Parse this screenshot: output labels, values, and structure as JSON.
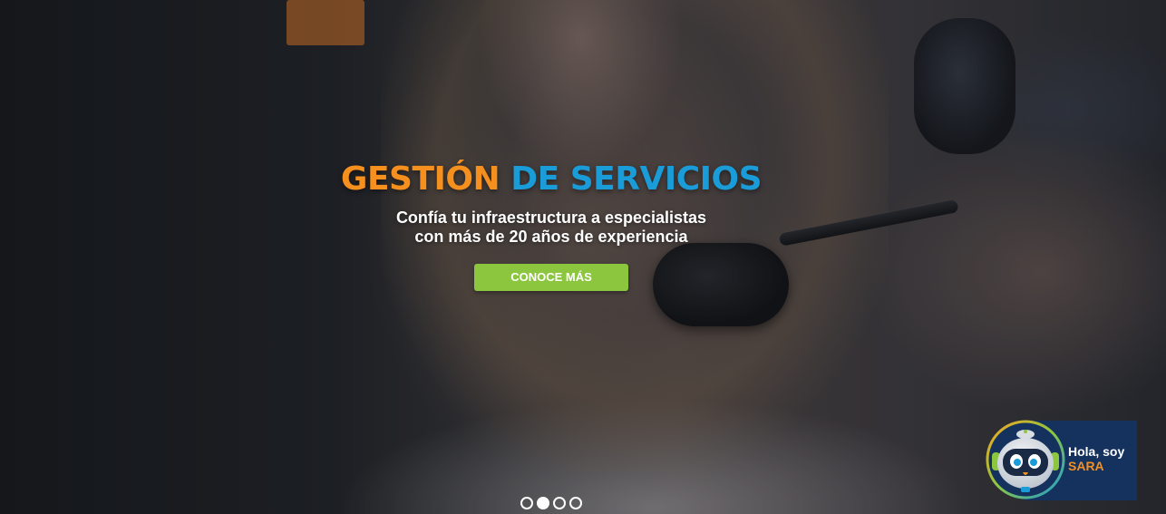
{
  "hero": {
    "title_part1": "GESTIÓN",
    "title_part2": "DE SERVICIOS",
    "subtitle_line1": "Confía tu infraestructura a especialistas",
    "subtitle_line2": "con más de 20 años de experiencia",
    "cta_label": "CONOCE MÁS",
    "background_image": "woman-with-headset-photo"
  },
  "carousel": {
    "slide_count": 4,
    "active_index": 1
  },
  "chat_widget": {
    "greeting": "Hola, soy",
    "name": "SARA",
    "avatar_icon": "robot-avatar-icon"
  },
  "colors": {
    "accent_orange": "#f5901e",
    "accent_blue": "#1a9cd8",
    "cta_green": "#8cc63f",
    "chat_navy": "#15315e"
  }
}
